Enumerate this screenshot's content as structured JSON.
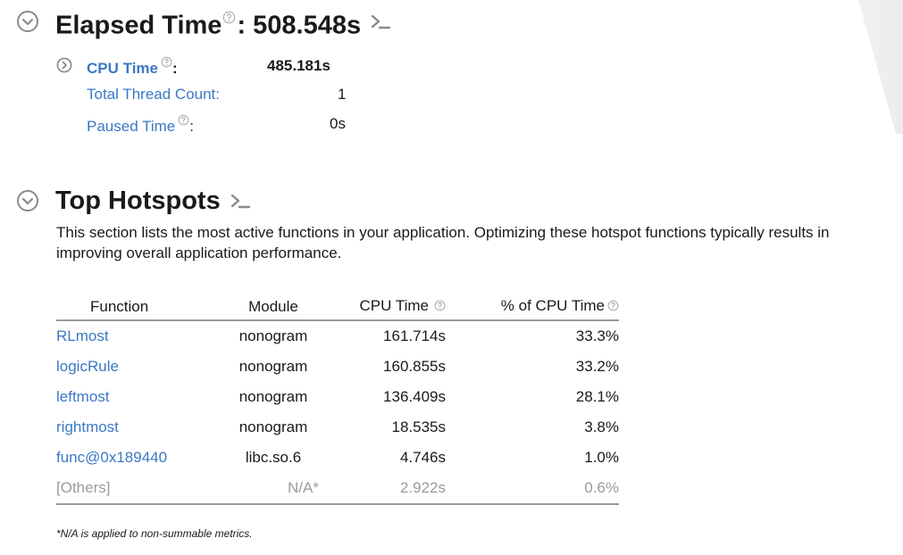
{
  "elapsed": {
    "title": "Elapsed Time",
    "value_text": ": 508.548s",
    "metrics": [
      {
        "label": "CPU Time",
        "suffix": ":",
        "value": "485.181s"
      },
      {
        "label": "Total Thread Count:",
        "value": "1"
      },
      {
        "label": "Paused Time",
        "suffix": ":",
        "value": "0s"
      }
    ]
  },
  "hotspots": {
    "title": "Top Hotspots",
    "description": "This section lists the most active functions in your application. Optimizing these hotspot functions typically results in improving overall application performance.",
    "columns": [
      "Function",
      "Module",
      "CPU Time",
      "% of CPU Time"
    ],
    "rows": [
      {
        "function": "RLmost",
        "module": "nonogram",
        "cpu_time": "161.714s",
        "percent": "33.3%"
      },
      {
        "function": "logicRule",
        "module": "nonogram",
        "cpu_time": "160.855s",
        "percent": "33.2%"
      },
      {
        "function": "leftmost",
        "module": "nonogram",
        "cpu_time": "136.409s",
        "percent": "28.1%"
      },
      {
        "function": "rightmost",
        "module": "nonogram",
        "cpu_time": "18.535s",
        "percent": "3.8%"
      },
      {
        "function": "func@0x189440",
        "module": "libc.so.6",
        "cpu_time": "4.746s",
        "percent": "1.0%"
      },
      {
        "function": "[Others]",
        "module": "N/A*",
        "cpu_time": "2.922s",
        "percent": "0.6%"
      }
    ],
    "footnote": "*N/A is applied to non-summable metrics."
  },
  "icons": {
    "collapse": "chevron-down-circle-icon",
    "expand": "chevron-right-circle-icon",
    "help": "question-circle-icon",
    "command_line": "command-prompt-icon"
  },
  "colors": {
    "link": "#3a78c4",
    "text": "#1a1a1a",
    "muted": "#9a9a9a",
    "icon_gray": "#8a8a8a"
  }
}
